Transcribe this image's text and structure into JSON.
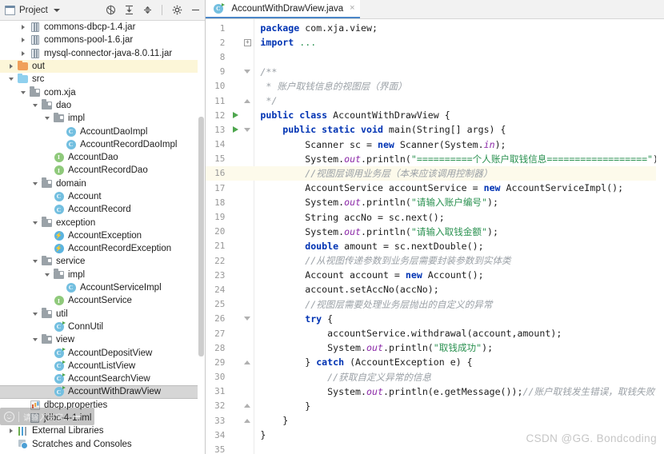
{
  "window": {
    "panel_title": "Project"
  },
  "toolbar": {
    "icons": [
      {
        "name": "locate-target-icon",
        "glyph": "⊕"
      },
      {
        "name": "expand-all-icon",
        "glyph": "↧"
      },
      {
        "name": "collapse-all-icon",
        "glyph": "↥"
      },
      {
        "name": "settings-gear-icon",
        "glyph": "⚙"
      },
      {
        "name": "minimize-icon",
        "glyph": "–"
      }
    ]
  },
  "tree": [
    {
      "label": "commons-dbcp-1.4.jar",
      "indent": 1,
      "arrow": "right",
      "icon": "jar",
      "hl": ""
    },
    {
      "label": "commons-pool-1.6.jar",
      "indent": 1,
      "arrow": "right",
      "icon": "jar",
      "hl": ""
    },
    {
      "label": "mysql-connector-java-8.0.11.jar",
      "indent": 1,
      "arrow": "right",
      "icon": "jar",
      "hl": ""
    },
    {
      "label": "out",
      "indent": 0,
      "arrow": "right",
      "icon": "folder-orange",
      "hl": "yellow"
    },
    {
      "label": "src",
      "indent": 0,
      "arrow": "down",
      "icon": "folder-blue",
      "hl": ""
    },
    {
      "label": "com.xja",
      "indent": 1,
      "arrow": "down",
      "icon": "package",
      "hl": ""
    },
    {
      "label": "dao",
      "indent": 2,
      "arrow": "down",
      "icon": "package",
      "hl": ""
    },
    {
      "label": "impl",
      "indent": 3,
      "arrow": "down",
      "icon": "package",
      "hl": ""
    },
    {
      "label": "AccountDaoImpl",
      "indent": 4,
      "arrow": "none",
      "icon": "class",
      "hl": ""
    },
    {
      "label": "AccountRecordDaoImpl",
      "indent": 4,
      "arrow": "none",
      "icon": "class",
      "hl": ""
    },
    {
      "label": "AccountDao",
      "indent": 3,
      "arrow": "none",
      "icon": "interface",
      "hl": ""
    },
    {
      "label": "AccountRecordDao",
      "indent": 3,
      "arrow": "none",
      "icon": "interface",
      "hl": ""
    },
    {
      "label": "domain",
      "indent": 2,
      "arrow": "down",
      "icon": "package",
      "hl": ""
    },
    {
      "label": "Account",
      "indent": 3,
      "arrow": "none",
      "icon": "class",
      "hl": ""
    },
    {
      "label": "AccountRecord",
      "indent": 3,
      "arrow": "none",
      "icon": "class",
      "hl": ""
    },
    {
      "label": "exception",
      "indent": 2,
      "arrow": "down",
      "icon": "package",
      "hl": ""
    },
    {
      "label": "AccountException",
      "indent": 3,
      "arrow": "none",
      "icon": "exception",
      "hl": ""
    },
    {
      "label": "AccountRecordException",
      "indent": 3,
      "arrow": "none",
      "icon": "exception",
      "hl": ""
    },
    {
      "label": "service",
      "indent": 2,
      "arrow": "down",
      "icon": "package",
      "hl": ""
    },
    {
      "label": "impl",
      "indent": 3,
      "arrow": "down",
      "icon": "package",
      "hl": ""
    },
    {
      "label": "AccountServiceImpl",
      "indent": 4,
      "arrow": "none",
      "icon": "class",
      "hl": ""
    },
    {
      "label": "AccountService",
      "indent": 3,
      "arrow": "none",
      "icon": "interface",
      "hl": ""
    },
    {
      "label": "util",
      "indent": 2,
      "arrow": "down",
      "icon": "package",
      "hl": ""
    },
    {
      "label": "ConnUtil",
      "indent": 3,
      "arrow": "none",
      "icon": "class-main",
      "hl": ""
    },
    {
      "label": "view",
      "indent": 2,
      "arrow": "down",
      "icon": "package",
      "hl": ""
    },
    {
      "label": "AccountDepositView",
      "indent": 3,
      "arrow": "none",
      "icon": "class-main",
      "hl": ""
    },
    {
      "label": "AccountListView",
      "indent": 3,
      "arrow": "none",
      "icon": "class-main",
      "hl": ""
    },
    {
      "label": "AccountSearchView",
      "indent": 3,
      "arrow": "none",
      "icon": "class-main",
      "hl": ""
    },
    {
      "label": "AccountWithDrawView",
      "indent": 3,
      "arrow": "none",
      "icon": "class-main",
      "hl": "gray"
    },
    {
      "label": "dbcp.properties",
      "indent": 1,
      "arrow": "none",
      "icon": "properties",
      "hl": ""
    },
    {
      "label": "jdbc-4-1.iml",
      "indent": 1,
      "arrow": "none",
      "icon": "iml",
      "hl": ""
    },
    {
      "label": "External Libraries",
      "indent": 0,
      "arrow": "right",
      "icon": "ext-lib",
      "hl": ""
    },
    {
      "label": "Scratches and Consoles",
      "indent": 0,
      "arrow": "none",
      "icon": "scratches",
      "hl": ""
    }
  ],
  "editor": {
    "tab": {
      "label": "AccountWithDrawView.java",
      "close_glyph": "×"
    },
    "lines": [
      {
        "n": "1",
        "run": false,
        "fold": "",
        "hl": false,
        "html": "<span class='kw'>package</span> <span class='plain'>com.xja.view;</span>"
      },
      {
        "n": "2",
        "run": false,
        "fold": "plus",
        "hl": false,
        "html": "<span class='kw'>import</span> <span class='str'>...</span>"
      },
      {
        "n": "8",
        "run": false,
        "fold": "",
        "hl": false,
        "html": ""
      },
      {
        "n": "9",
        "run": false,
        "fold": "down",
        "hl": false,
        "html": "<span class='doc'>/**</span>"
      },
      {
        "n": "10",
        "run": false,
        "fold": "",
        "hl": false,
        "html": "<span class='doc'> * 账户取钱信息的视图层（界面）</span>"
      },
      {
        "n": "11",
        "run": false,
        "fold": "up",
        "hl": false,
        "html": "<span class='doc'> */</span>"
      },
      {
        "n": "12",
        "run": true,
        "fold": "",
        "hl": false,
        "html": "<span class='kw'>public class</span> <span class='plain'>AccountWithDrawView {</span>"
      },
      {
        "n": "13",
        "run": true,
        "fold": "down",
        "hl": false,
        "html": "    <span class='kw'>public static void</span> <span class='plain'>main(String[] args) {</span>"
      },
      {
        "n": "14",
        "run": false,
        "fold": "",
        "hl": false,
        "html": "        <span class='plain'>Scanner sc = </span><span class='kw'>new</span><span class='plain'> Scanner(System.</span><span class='fld'>in</span><span class='plain'>);</span>"
      },
      {
        "n": "15",
        "run": false,
        "fold": "",
        "hl": false,
        "html": "        <span class='plain'>System.</span><span class='fld'>out</span><span class='plain'>.println(</span><span class='str'>\"==========个人账户取钱信息==================\"</span><span class='plain'>);</span>"
      },
      {
        "n": "16",
        "run": false,
        "fold": "",
        "hl": true,
        "html": "        <span class='cmt'>//视图层调用业务层（本来应该调用控制器）</span>"
      },
      {
        "n": "17",
        "run": false,
        "fold": "",
        "hl": false,
        "html": "        <span class='plain'>AccountService accountService = </span><span class='kw'>new</span><span class='plain'> AccountServiceImpl();</span>"
      },
      {
        "n": "18",
        "run": false,
        "fold": "",
        "hl": false,
        "html": "        <span class='plain'>System.</span><span class='fld'>out</span><span class='plain'>.println(</span><span class='str'>\"请输入账户编号\"</span><span class='plain'>);</span>"
      },
      {
        "n": "19",
        "run": false,
        "fold": "",
        "hl": false,
        "html": "        <span class='plain'>String accNo = sc.next();</span>"
      },
      {
        "n": "20",
        "run": false,
        "fold": "",
        "hl": false,
        "html": "        <span class='plain'>System.</span><span class='fld'>out</span><span class='plain'>.println(</span><span class='str'>\"请输入取钱金额\"</span><span class='plain'>);</span>"
      },
      {
        "n": "21",
        "run": false,
        "fold": "",
        "hl": false,
        "html": "        <span class='kw'>double</span><span class='plain'> amount = sc.nextDouble();</span>"
      },
      {
        "n": "22",
        "run": false,
        "fold": "",
        "hl": false,
        "html": "        <span class='cmt'>//从视图传递参数到业务层需要封装参数到实体类</span>"
      },
      {
        "n": "23",
        "run": false,
        "fold": "",
        "hl": false,
        "html": "        <span class='plain'>Account account = </span><span class='kw'>new</span><span class='plain'> Account();</span>"
      },
      {
        "n": "24",
        "run": false,
        "fold": "",
        "hl": false,
        "html": "        <span class='plain'>account.setAccNo(accNo);</span>"
      },
      {
        "n": "25",
        "run": false,
        "fold": "",
        "hl": false,
        "html": "        <span class='cmt'>//视图层需要处理业务层抛出的自定义的异常</span>"
      },
      {
        "n": "26",
        "run": false,
        "fold": "down",
        "hl": false,
        "html": "        <span class='kw'>try</span><span class='plain'> {</span>"
      },
      {
        "n": "27",
        "run": false,
        "fold": "",
        "hl": false,
        "html": "            <span class='plain'>accountService.withdrawal(account,amount);</span>"
      },
      {
        "n": "28",
        "run": false,
        "fold": "",
        "hl": false,
        "html": "            <span class='plain'>System.</span><span class='fld'>out</span><span class='plain'>.println(</span><span class='str'>\"取钱成功\"</span><span class='plain'>);</span>"
      },
      {
        "n": "29",
        "run": false,
        "fold": "up",
        "hl": false,
        "html": "        <span class='plain'>} </span><span class='kw'>catch</span><span class='plain'> (AccountException e) {</span>"
      },
      {
        "n": "30",
        "run": false,
        "fold": "",
        "hl": false,
        "html": "            <span class='cmt'>//获取自定义异常的信息</span>"
      },
      {
        "n": "31",
        "run": false,
        "fold": "",
        "hl": false,
        "html": "            <span class='plain'>System.</span><span class='fld'>out</span><span class='plain'>.println(e.getMessage());</span><span class='cmt'>//账户取钱发生错误，取钱失败</span>"
      },
      {
        "n": "32",
        "run": false,
        "fold": "up",
        "hl": false,
        "html": "        <span class='plain'>}</span>"
      },
      {
        "n": "33",
        "run": false,
        "fold": "up",
        "hl": false,
        "html": "    <span class='plain'>}</span>"
      },
      {
        "n": "34",
        "run": false,
        "fold": "",
        "hl": false,
        "html": "<span class='plain'>}</span>"
      },
      {
        "n": "35",
        "run": false,
        "fold": "",
        "hl": false,
        "html": ""
      }
    ]
  },
  "overlay": {
    "ime_text": "请输入文字...",
    "watermark": "CSDN @GG. Bondcoding"
  },
  "colors": {
    "accent_tab": "#4a86c8",
    "keyword": "#0033b3",
    "string": "#2a9150",
    "comment": "#9aa0a6",
    "field": "#8c2aa8",
    "selection_row": "#d6d6d6",
    "highlight_row": "#fcf6d8"
  }
}
